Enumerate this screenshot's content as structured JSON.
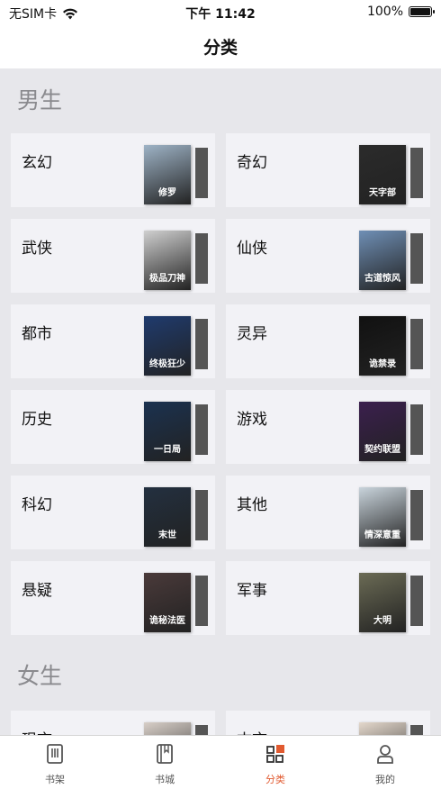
{
  "status_bar": {
    "carrier": "无SIM卡",
    "time": "下午 11:42",
    "battery": "100%"
  },
  "header": {
    "title": "分类"
  },
  "sections": [
    {
      "title": "男生",
      "categories": [
        {
          "label": "玄幻",
          "cover_text": "修罗",
          "cover_color": "#9eb3c6"
        },
        {
          "label": "奇幻",
          "cover_text": "天字部",
          "cover_color": "#2b2b2b"
        },
        {
          "label": "武侠",
          "cover_text": "极品刀神",
          "cover_color": "#cfcfcf"
        },
        {
          "label": "仙侠",
          "cover_text": "古道惊风",
          "cover_color": "#6f8fb5"
        },
        {
          "label": "都市",
          "cover_text": "终极狂少",
          "cover_color": "#1f3b6e"
        },
        {
          "label": "灵异",
          "cover_text": "诡禁录",
          "cover_color": "#111111"
        },
        {
          "label": "历史",
          "cover_text": "一日局",
          "cover_color": "#1b3250"
        },
        {
          "label": "游戏",
          "cover_text": "契约联盟",
          "cover_color": "#3b1f4e"
        },
        {
          "label": "科幻",
          "cover_text": "末世",
          "cover_color": "#233040"
        },
        {
          "label": "其他",
          "cover_text": "情深意重",
          "cover_color": "#c9d4dc"
        },
        {
          "label": "悬疑",
          "cover_text": "诡秘法医",
          "cover_color": "#4a3a3a"
        },
        {
          "label": "军事",
          "cover_text": "大明",
          "cover_color": "#6b6b55"
        }
      ]
    },
    {
      "title": "女生",
      "categories": [
        {
          "label": "现言",
          "cover_text": "",
          "cover_color": "#d8cfc8"
        },
        {
          "label": "古言",
          "cover_text": "",
          "cover_color": "#e4d8cc"
        }
      ]
    }
  ],
  "tabbar": {
    "items": [
      {
        "label": "书架",
        "icon": "bookshelf-icon",
        "active": false
      },
      {
        "label": "书城",
        "icon": "bookstore-icon",
        "active": false
      },
      {
        "label": "分类",
        "icon": "category-icon",
        "active": true
      },
      {
        "label": "我的",
        "icon": "profile-icon",
        "active": false
      }
    ]
  },
  "colors": {
    "accent": "#e15a30",
    "background": "#e7e7eb",
    "card": "#f2f2f6"
  }
}
